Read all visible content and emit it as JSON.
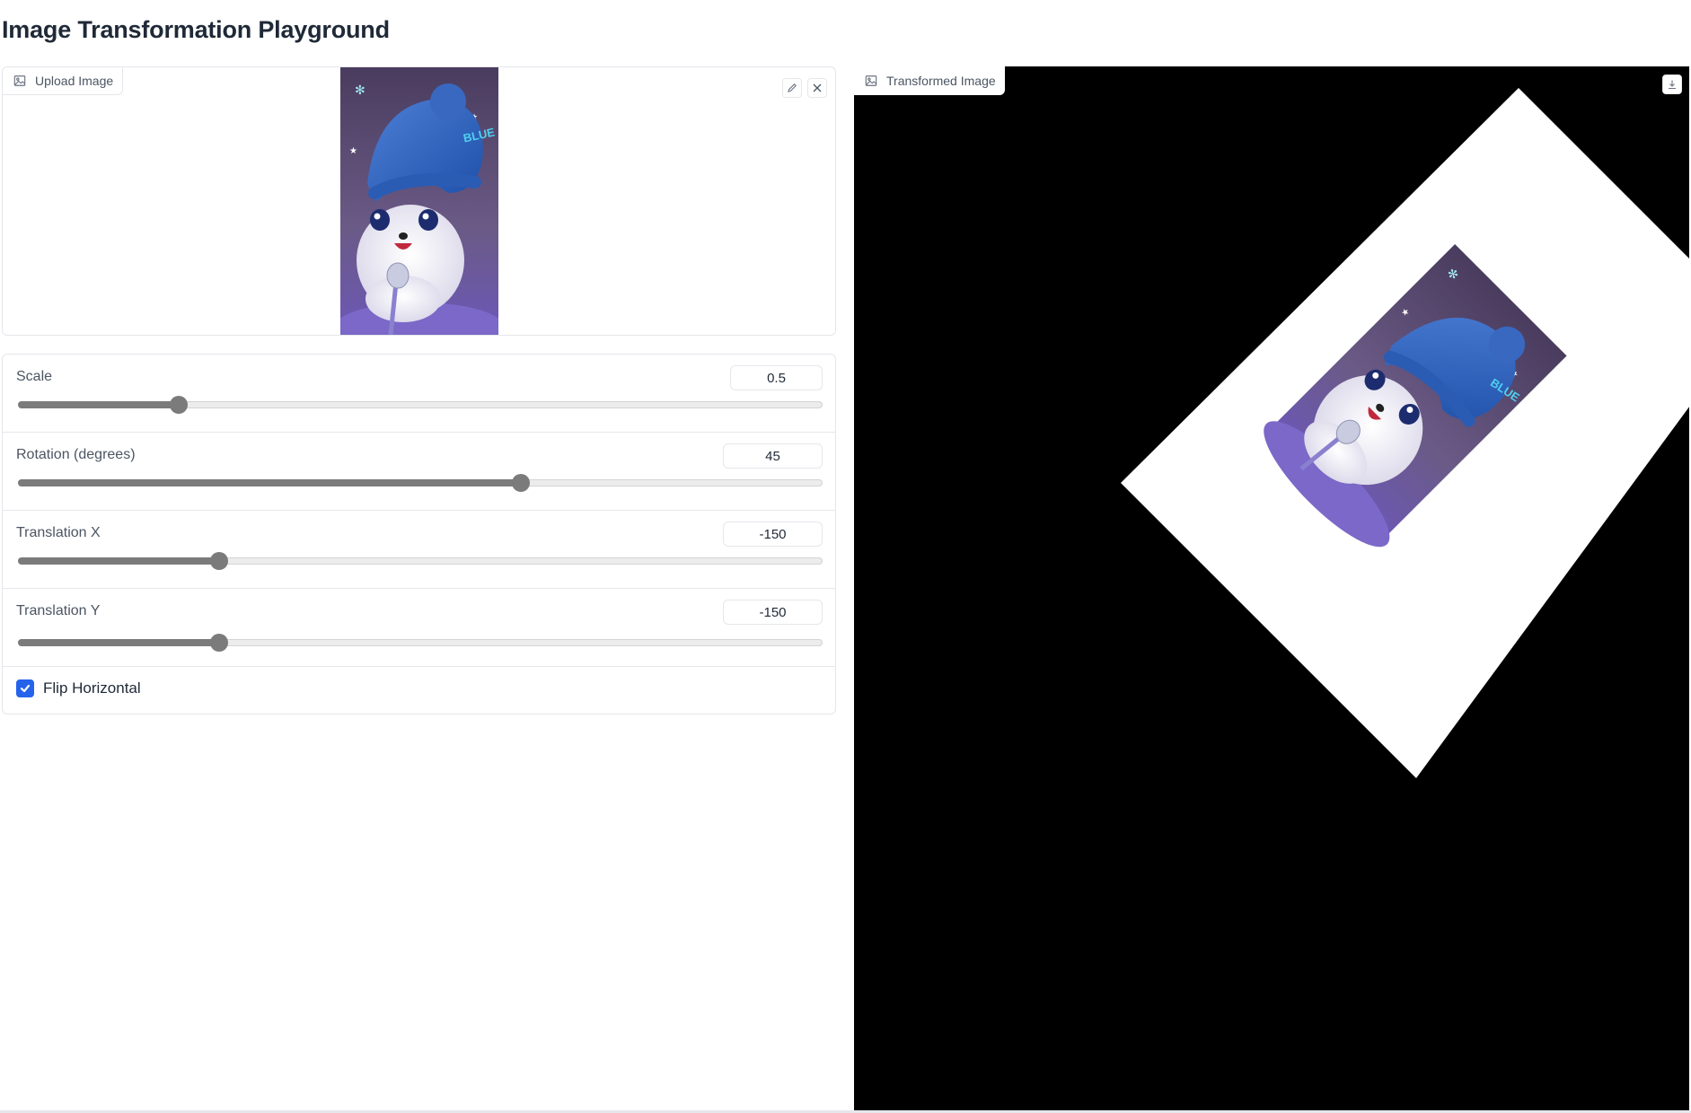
{
  "page": {
    "title": "Image Transformation Playground"
  },
  "upload": {
    "label": "Upload Image",
    "image_icon": "image-icon",
    "edit_icon": "pencil-icon",
    "clear_icon": "close-icon"
  },
  "controls": {
    "scale": {
      "label": "Scale",
      "value": "0.5",
      "fraction": 0.2
    },
    "rotation": {
      "label": "Rotation (degrees)",
      "value": "45",
      "fraction": 0.625
    },
    "translation_x": {
      "label": "Translation X",
      "value": "-150",
      "fraction": 0.25
    },
    "translation_y": {
      "label": "Translation Y",
      "value": "-150",
      "fraction": 0.25
    },
    "flip_horizontal": {
      "label": "Flip Horizontal",
      "checked": true
    }
  },
  "output": {
    "label": "Transformed Image",
    "image_icon": "image-icon",
    "download_icon": "download-icon"
  },
  "colors": {
    "accent": "#2563eb",
    "slider": "#7b7b7b",
    "border": "#e5e7eb",
    "output_bg": "#000000"
  }
}
